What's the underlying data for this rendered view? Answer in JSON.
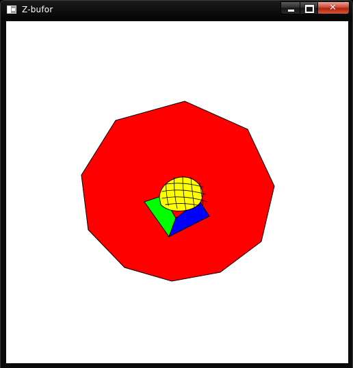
{
  "window": {
    "title": "Z-bufor",
    "controls": {
      "minimize_icon": "minimize-icon",
      "maximize_icon": "maximize-icon",
      "close_icon": "close-icon",
      "close_glyph": "✕"
    }
  },
  "scene": {
    "background_color": "#ffffff",
    "shapes": [
      {
        "name": "red-decagon",
        "color": "#ff0000"
      },
      {
        "name": "green-face",
        "color": "#00ff00"
      },
      {
        "name": "blue-face",
        "color": "#0000ff"
      },
      {
        "name": "yellow-sphere",
        "color": "#ffff00",
        "grid_color": "#000000"
      }
    ]
  }
}
